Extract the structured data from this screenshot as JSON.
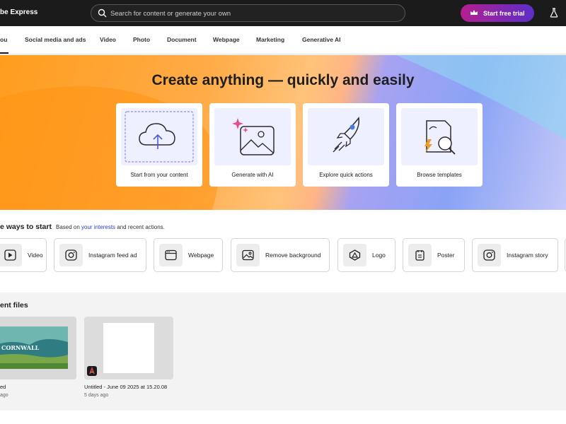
{
  "app": {
    "title": "be Express"
  },
  "search": {
    "placeholder": "Search for content or generate your own"
  },
  "header": {
    "trial_label": "Start free trial"
  },
  "tabs": [
    {
      "label": "ou"
    },
    {
      "label": "Social media and ads"
    },
    {
      "label": "Video"
    },
    {
      "label": "Photo"
    },
    {
      "label": "Document"
    },
    {
      "label": "Webpage"
    },
    {
      "label": "Marketing"
    },
    {
      "label": "Generative AI"
    }
  ],
  "hero": {
    "title": "Create anything — quickly and easily",
    "cards": [
      {
        "label": "Start from your content",
        "icon": "cloud-upload-icon"
      },
      {
        "label": "Generate with AI",
        "icon": "sparkle-image-icon"
      },
      {
        "label": "Explore quick actions",
        "icon": "rocket-icon"
      },
      {
        "label": "Browse templates",
        "icon": "template-search-icon"
      }
    ]
  },
  "quick": {
    "title": "e ways to start",
    "subtitle_prefix": "Based on ",
    "subtitle_link": "your interests",
    "subtitle_suffix": " and recent actions.",
    "items": [
      {
        "label": "Video",
        "icon": "play-icon"
      },
      {
        "label": "Instagram feed ad",
        "icon": "instagram-icon"
      },
      {
        "label": "Webpage",
        "icon": "browser-window-icon"
      },
      {
        "label": "Remove background",
        "icon": "image-icon"
      },
      {
        "label": "Logo",
        "icon": "logo-shape-icon"
      },
      {
        "label": "Poster",
        "icon": "poster-icon"
      },
      {
        "label": "Instagram story",
        "icon": "instagram-icon"
      }
    ]
  },
  "recent": {
    "title": "ent files",
    "files": [
      {
        "name": "ed",
        "date": "ago",
        "thumb_text": "CORNWALL"
      },
      {
        "name": "Untitled - June 09 2025 at 15.20.08",
        "date": "5 days ago"
      }
    ]
  },
  "colors": {
    "accent_link": "#2a3fcb",
    "trial_gradient_start": "#b31f8f",
    "trial_gradient_end": "#5c2ec9"
  }
}
